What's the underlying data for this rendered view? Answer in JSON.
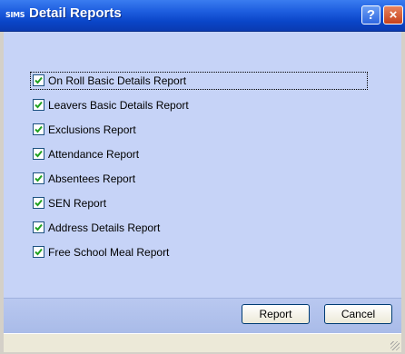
{
  "window": {
    "app_icon_text": "SIMS",
    "title": "Detail Reports",
    "help_glyph": "?",
    "close_glyph": "×"
  },
  "reports": [
    {
      "label": "On Roll Basic Details Report",
      "checked": true
    },
    {
      "label": "Leavers Basic Details Report",
      "checked": true
    },
    {
      "label": "Exclusions Report",
      "checked": true
    },
    {
      "label": "Attendance Report",
      "checked": true
    },
    {
      "label": "Absentees Report",
      "checked": true
    },
    {
      "label": "SEN Report",
      "checked": true
    },
    {
      "label": "Address Details Report",
      "checked": true
    },
    {
      "label": "Free School Meal Report",
      "checked": true
    }
  ],
  "buttons": {
    "report": "Report",
    "cancel": "Cancel"
  },
  "colors": {
    "titlebar": "#0a45c8",
    "content_bg": "#c6d3f7",
    "button_bar": "#b9c8f0"
  }
}
